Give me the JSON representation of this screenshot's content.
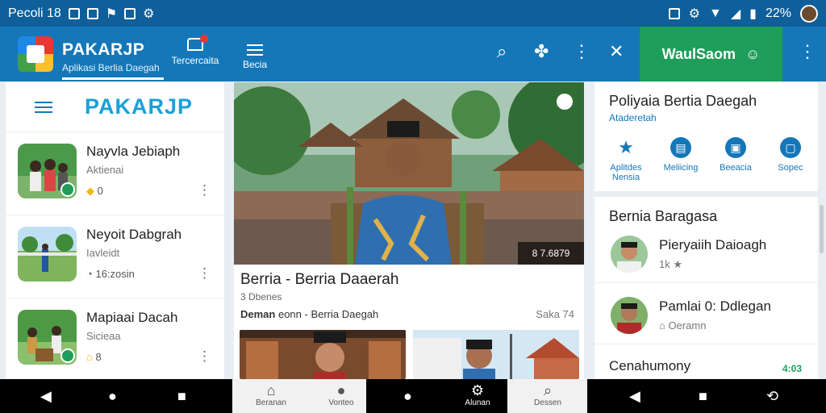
{
  "status": {
    "time": "Pecoli 18",
    "battery_text": "22%"
  },
  "appbar": {
    "brand": "PAKARJP",
    "tagline": "Aplikasi Berlia Daegah",
    "tab_trust": "Tercercaita",
    "tab_menu": "Becia",
    "welcome": "WaulSaom",
    "icons": [
      "search-icon",
      "puzzle-icon",
      "more-icon",
      "expand-icon",
      "user-icon"
    ]
  },
  "left": {
    "logo": "PAKARJP",
    "items": [
      {
        "title": "Nayvla Jebiaph",
        "sub": "Aktienai",
        "meta": "0"
      },
      {
        "title": "Neyoit Dabgrah",
        "sub": "Iavleidt",
        "meta": "16:zosin"
      },
      {
        "title": "Mapiaai Dacah",
        "sub": "Sicieaa",
        "meta": "8"
      }
    ]
  },
  "hero": {
    "badge": "8 7.6879"
  },
  "article": {
    "title": "Berria - Berria Daaerah",
    "meta": "3 Dbenes",
    "byline_bold": "Deman",
    "byline_rest": " eonn - Berria Daegah",
    "date": "Saka 74"
  },
  "right": {
    "card1_title": "Poliyaia Bertia Daegah",
    "card1_sub": "Ataderetah",
    "shortcuts": [
      {
        "label": "Aplitdes Nensia",
        "glyph": "★"
      },
      {
        "label": "Meliicing",
        "glyph": "▤"
      },
      {
        "label": "Beeacia",
        "glyph": "▣"
      },
      {
        "label": "Sopec",
        "glyph": "▢"
      }
    ],
    "card2_title": "Bernia Baragasa",
    "people": [
      {
        "name": "Pieryaiih Daioagh",
        "meta": "1k"
      },
      {
        "name": "Pamlai 0: Ddlegan",
        "meta": "Oeramn"
      }
    ],
    "footer_text": "Cenahumony",
    "footer_num": "4:03"
  },
  "bottom": {
    "tabs": [
      "Beranan",
      "Vonteo",
      "Alunan",
      "Dessen"
    ]
  },
  "colors": {
    "primary": "#1577b8",
    "accent": "#1e9e5a",
    "status": "#0f5f9a"
  }
}
